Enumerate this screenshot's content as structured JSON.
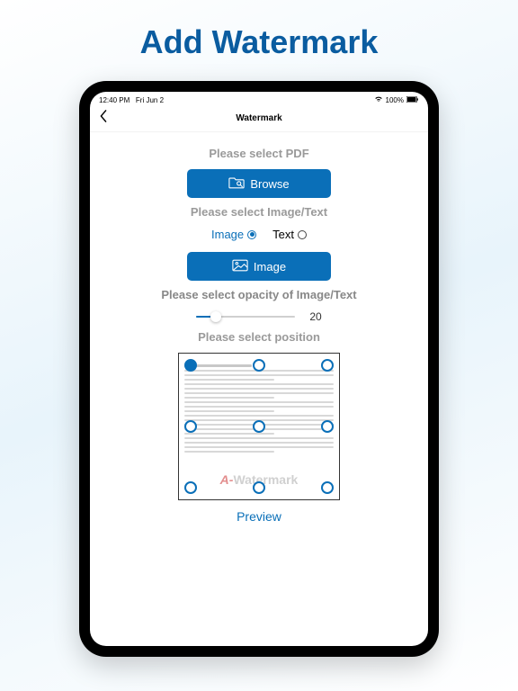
{
  "hero": {
    "title": "Add Watermark"
  },
  "status": {
    "time": "12:40 PM",
    "date": "Fri Jun 2",
    "battery": "100%"
  },
  "nav": {
    "title": "Watermark"
  },
  "sections": {
    "selectPdf": "Please select PDF",
    "selectImageText": "Please select Image/Text",
    "selectOpacity": "Please select opacity of Image/Text",
    "selectPosition": "Please select position"
  },
  "buttons": {
    "browse": "Browse",
    "image": "Image",
    "preview": "Preview"
  },
  "radios": {
    "image": "Image",
    "text": "Text",
    "selected": "image"
  },
  "opacity": {
    "value": 20,
    "min": 0,
    "max": 100
  },
  "position": {
    "grid": 9,
    "selected": 0
  },
  "watermark_preview": {
    "text1": "Watermark",
    "a": "A-",
    "rest": "Watermark"
  }
}
